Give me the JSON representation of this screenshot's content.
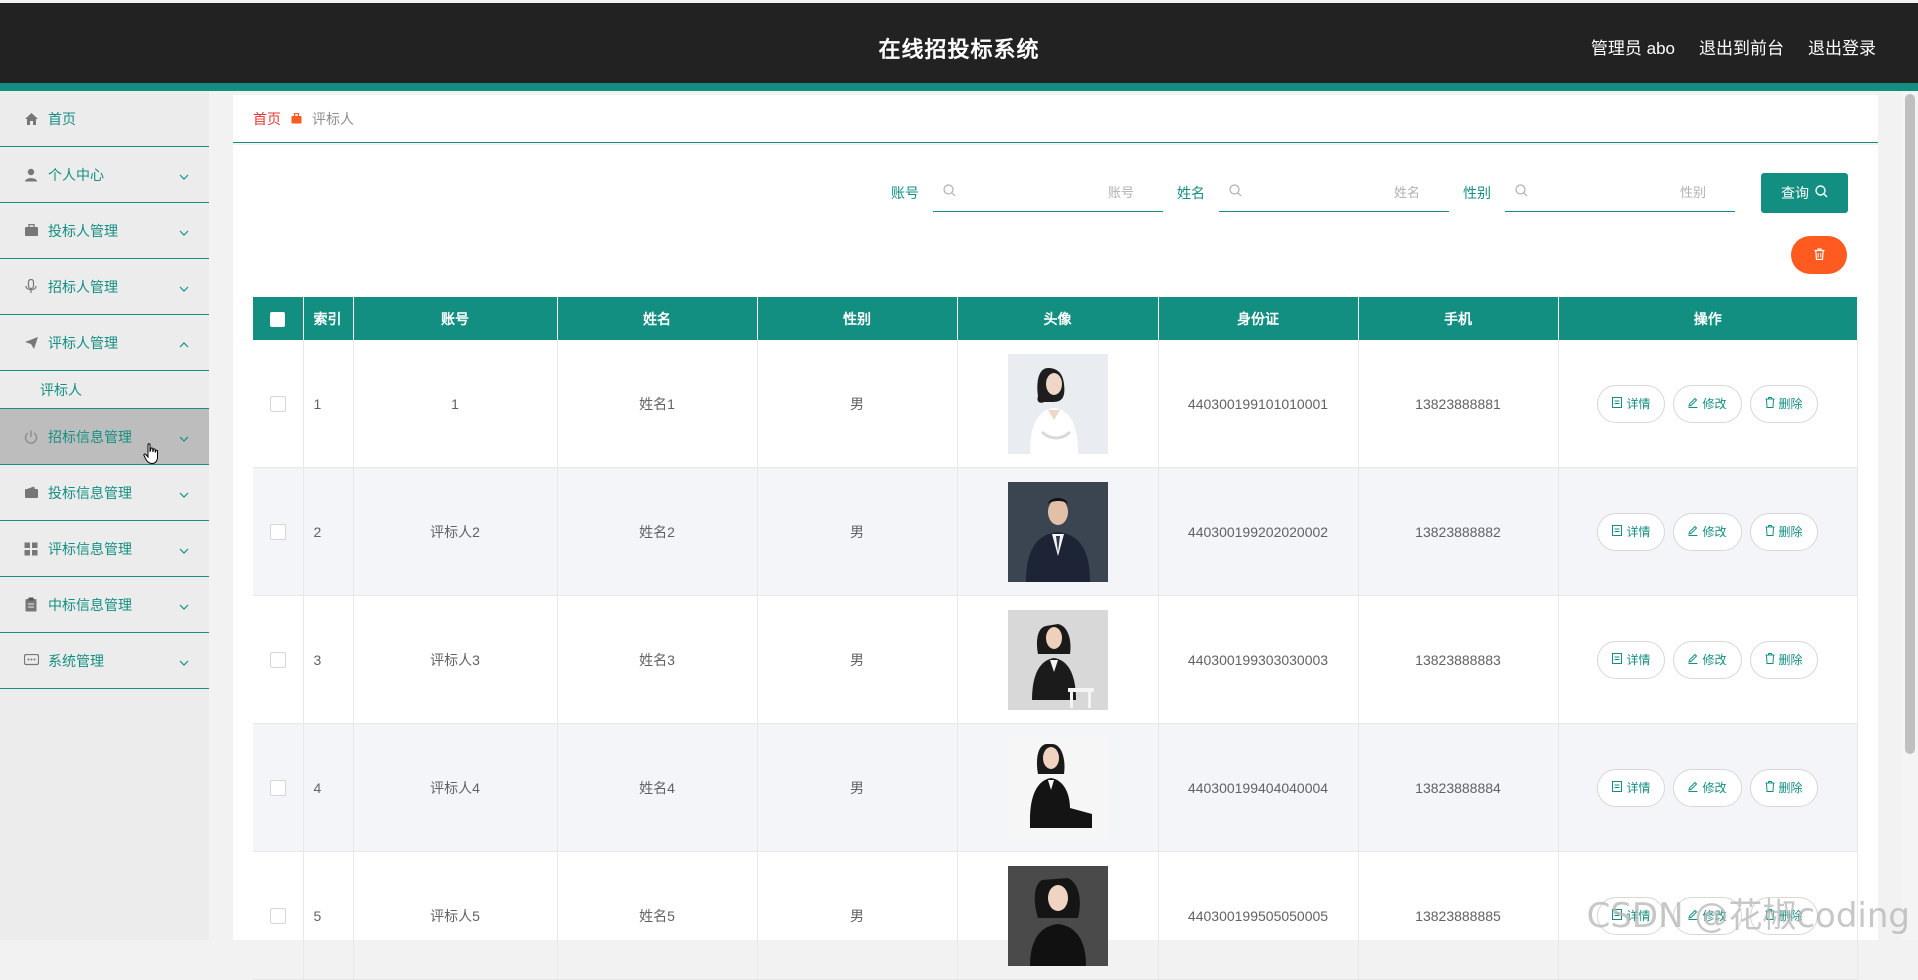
{
  "header": {
    "title": "在线招投标系统",
    "links": [
      "管理员 abo",
      "退出到前台",
      "退出登录"
    ]
  },
  "sidebar": {
    "items": [
      {
        "label": "首页",
        "icon": "home-icon",
        "expandable": false
      },
      {
        "label": "个人中心",
        "icon": "user-icon",
        "expandable": true
      },
      {
        "label": "投标人管理",
        "icon": "briefcase-icon",
        "expandable": true
      },
      {
        "label": "招标人管理",
        "icon": "microphone-icon",
        "expandable": true
      },
      {
        "label": "评标人管理",
        "icon": "send-icon",
        "expandable": true,
        "expanded": true,
        "children": [
          "评标人"
        ]
      },
      {
        "label": "招标信息管理",
        "icon": "power-icon",
        "expandable": true,
        "hovered": true
      },
      {
        "label": "投标信息管理",
        "icon": "wallet-icon",
        "expandable": true
      },
      {
        "label": "评标信息管理",
        "icon": "grid-icon",
        "expandable": true
      },
      {
        "label": "中标信息管理",
        "icon": "clipboard-icon",
        "expandable": true
      },
      {
        "label": "系统管理",
        "icon": "chat-icon",
        "expandable": true
      }
    ]
  },
  "breadcrumb": {
    "home": "首页",
    "current": "评标人"
  },
  "search": {
    "account_label": "账号",
    "account_placeholder": "账号",
    "name_label": "姓名",
    "name_placeholder": "姓名",
    "gender_label": "性别",
    "gender_placeholder": "性别",
    "query_label": "查询"
  },
  "table": {
    "columns": [
      "索引",
      "账号",
      "姓名",
      "性别",
      "头像",
      "身份证",
      "手机",
      "操作"
    ],
    "rows": [
      {
        "index": "1",
        "account": "1",
        "name": "姓名1",
        "gender": "男",
        "id_card": "440300199101010001",
        "phone": "13823888881"
      },
      {
        "index": "2",
        "account": "评标人2",
        "name": "姓名2",
        "gender": "男",
        "id_card": "440300199202020002",
        "phone": "13823888882"
      },
      {
        "index": "3",
        "account": "评标人3",
        "name": "姓名3",
        "gender": "男",
        "id_card": "440300199303030003",
        "phone": "13823888883"
      },
      {
        "index": "4",
        "account": "评标人4",
        "name": "姓名4",
        "gender": "男",
        "id_card": "440300199404040004",
        "phone": "13823888884"
      },
      {
        "index": "5",
        "account": "评标人5",
        "name": "姓名5",
        "gender": "男",
        "id_card": "440300199505050005",
        "phone": "13823888885"
      }
    ],
    "actions": {
      "detail": "详情",
      "edit": "修改",
      "delete": "删除"
    }
  },
  "watermark": "CSDN @花椒coding",
  "colors": {
    "primary": "#138f82",
    "topbar": "#222222",
    "danger": "#ff5a1f",
    "breadcrumb_home": "#e53935"
  }
}
